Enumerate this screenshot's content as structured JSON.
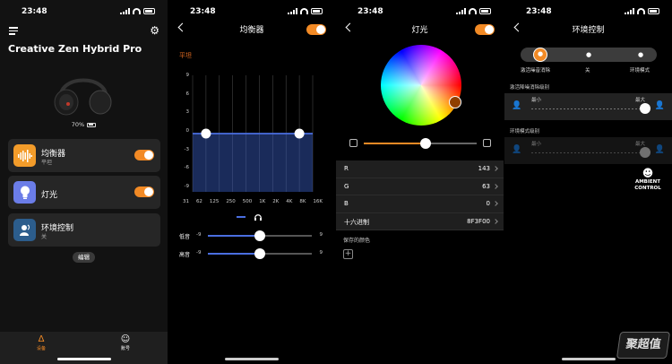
{
  "status": {
    "time": "23:48"
  },
  "home": {
    "device_name": "Creative Zen Hybrid Pro",
    "battery": "70%",
    "cards": [
      {
        "label": "均衡器",
        "sub": "平坦",
        "icon": "equalizer-icon",
        "color": "#f39c2a",
        "enabled": true
      },
      {
        "label": "灯光",
        "sub": "",
        "icon": "lightbulb-icon",
        "color": "#6b7de8",
        "enabled": true
      },
      {
        "label": "环境控制",
        "sub": "关",
        "icon": "ambient-control-icon",
        "color": "#2c5d8c",
        "enabled": null
      }
    ],
    "edit_label": "编辑",
    "tabs": [
      {
        "label": "设备",
        "icon": "creative-logo-icon",
        "active": true
      },
      {
        "label": "账号",
        "icon": "account-icon",
        "active": false
      }
    ]
  },
  "equalizer": {
    "title": "均衡器",
    "preset": "平坦",
    "y_ticks": [
      "9",
      "6",
      "3",
      "0",
      "-3",
      "-6",
      "-9"
    ],
    "bands": [
      "31",
      "62",
      "125",
      "250",
      "500",
      "1K",
      "2K",
      "4K",
      "8K",
      "16K"
    ],
    "gains": [
      0,
      0,
      0,
      0,
      0,
      0,
      0,
      0,
      0,
      0
    ],
    "bass": {
      "label": "低音",
      "min": "-9",
      "max": "9",
      "value": 0
    },
    "treble": {
      "label": "高音",
      "min": "-9",
      "max": "9",
      "value": 0
    }
  },
  "lighting": {
    "title": "灯光",
    "rows": [
      {
        "label": "R",
        "value": "143"
      },
      {
        "label": "G",
        "value": "63"
      },
      {
        "label": "B",
        "value": "0"
      },
      {
        "label": "十六进制",
        "value": "8F3F00"
      }
    ],
    "saved_colors_title": "保存的颜色",
    "brightness": 0.55,
    "current_color": "#8F3F00"
  },
  "ambient": {
    "title": "环境控制",
    "modes": [
      "激活噪音消除",
      "关",
      "环境模式"
    ],
    "active_mode": 0,
    "anc_title": "激活降噪消除级别",
    "ambient_title": "环境模式级别",
    "min_label": "最小",
    "max_label": "最大",
    "badge_line1": "AMBIENT",
    "badge_line2": "CONTROL",
    "anc_level": 1,
    "ambient_level": 1
  },
  "watermark": "聚超值",
  "accent": "#f28a25",
  "eq_fill": "#3a5fc8"
}
